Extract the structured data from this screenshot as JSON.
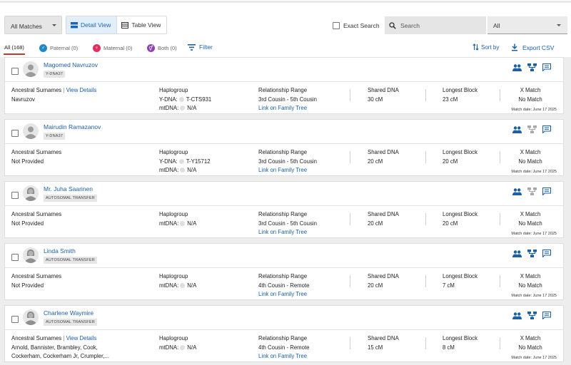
{
  "toolbar": {
    "matches_select": "All Matches",
    "detail_view": "Detail View",
    "table_view": "Table View",
    "exact_search": "Exact Search",
    "search_placeholder": "Search",
    "scope_select": "All"
  },
  "filters": {
    "all": "All (168)",
    "paternal": "Paternal (0)",
    "maternal": "Maternal (0)",
    "both": "Both (0)",
    "filter": "Filter",
    "sort_by": "Sort by",
    "export_csv": "Export CSV"
  },
  "colors": {
    "accent": "#1b5fa6",
    "paternal": "#1e88c7",
    "maternal": "#e0305c",
    "both": "#8e44ad"
  },
  "labels": {
    "ancestral_surnames": "Ancestral Surnames",
    "view_details": "View Details",
    "haplogroup": "Haplogroup",
    "relationship_range": "Relationship Range",
    "link_family_tree": "Link on Family Tree",
    "shared_dna": "Shared DNA",
    "longest_block": "Longest Block",
    "x_match": "X Match"
  },
  "matches": [
    {
      "name": "Magomed Navruzov",
      "badge": "Y-DNA37",
      "avatar": "male",
      "surnames_line1": "Navruzov",
      "surnames_line2": "",
      "has_details": true,
      "hap_line1_label": "Y-DNA:",
      "hap_line1_value": "T-CTS931",
      "hap_line2_label": "mtDNA:",
      "hap_line2_value": "N/A",
      "relationship": "3rd Cousin - 5th Cousin",
      "shared": "30 cM",
      "longest": "23 cM",
      "xmatch": "No Match",
      "match_date": "Match date: June 17 2025",
      "tree_icon_active": true
    },
    {
      "name": "Mairudin Ramazanov",
      "badge": "Y-DNA37",
      "avatar": "male",
      "surnames_line1": "Not Provided",
      "surnames_line2": "",
      "has_details": false,
      "hap_line1_label": "Y-DNA:",
      "hap_line1_value": "T-Y15712",
      "hap_line2_label": "mtDNA:",
      "hap_line2_value": "N/A",
      "relationship": "3rd Cousin - 5th Cousin",
      "shared": "20 cM",
      "longest": "20 cM",
      "xmatch": "No Match",
      "match_date": "Match date: June 17 2025",
      "tree_icon_active": false
    },
    {
      "name": "Mr. Juha Saarinen",
      "badge": "AUTOSOMAL TRANSFER",
      "avatar": "female",
      "surnames_line1": "Not Provided",
      "surnames_line2": "",
      "has_details": false,
      "hap_line1_label": "mtDNA:",
      "hap_line1_value": "N/A",
      "hap_line2_label": "",
      "hap_line2_value": "",
      "relationship": "3rd Cousin - 5th Cousin",
      "shared": "20 cM",
      "longest": "20 cM",
      "xmatch": "No Match",
      "match_date": "Match date: June 17 2025",
      "tree_icon_active": false
    },
    {
      "name": "Linda Smith",
      "badge": "AUTOSOMAL TRANSFER",
      "avatar": "female",
      "surnames_line1": "Not Provided",
      "surnames_line2": "",
      "has_details": false,
      "hap_line1_label": "mtDNA:",
      "hap_line1_value": "N/A",
      "hap_line2_label": "",
      "hap_line2_value": "",
      "relationship": "4th Cousin - Remote",
      "shared": "20 cM",
      "longest": "7 cM",
      "xmatch": "No Match",
      "match_date": "Match date: June 17 2025",
      "tree_icon_active": true
    },
    {
      "name": "Charlene Waymire",
      "badge": "AUTOSOMAL TRANSFER",
      "avatar": "female",
      "surnames_line1": "Arnold, Bannister, Brambley, Cook,",
      "surnames_line2": "Cockerham, Cockerham Jr, Crumpler,...",
      "has_details": true,
      "hap_line1_label": "mtDNA:",
      "hap_line1_value": "N/A",
      "hap_line2_label": "",
      "hap_line2_value": "",
      "relationship": "4th Cousin - Remote",
      "shared": "15 cM",
      "longest": "8 cM",
      "xmatch": "No Match",
      "match_date": "Match date: June 17 2025",
      "tree_icon_active": true
    }
  ]
}
